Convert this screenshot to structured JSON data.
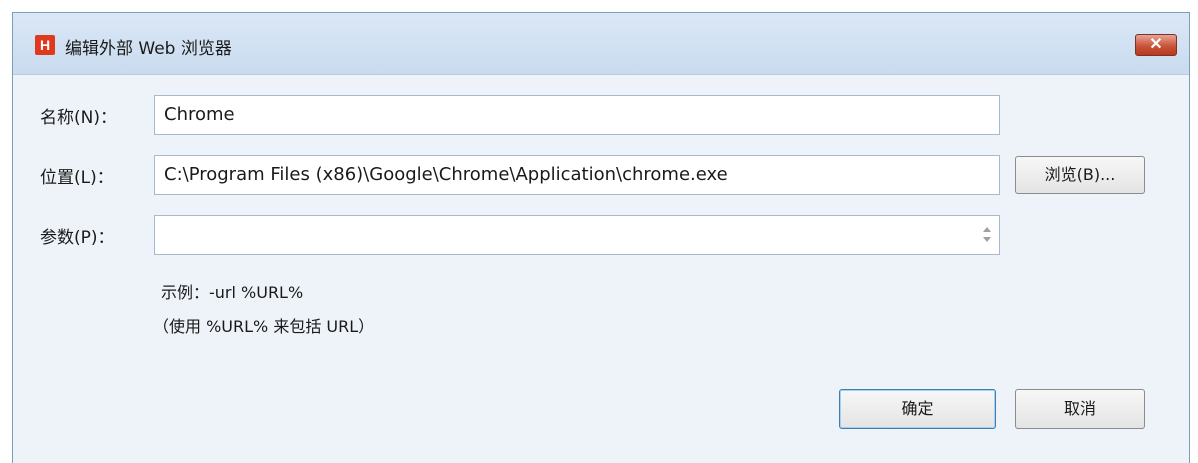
{
  "window": {
    "title": "编辑外部 Web 浏览器",
    "app_icon_letter": "H",
    "close_label": "✕"
  },
  "form": {
    "name_label": "名称(N)：",
    "name_value": "Chrome",
    "location_label": "位置(L)：",
    "location_value": "C:\\Program Files (x86)\\Google\\Chrome\\Application\\chrome.exe",
    "browse_label": "浏览(B)...",
    "params_label": "参数(P)：",
    "params_value": "",
    "hint_line1": "示例：-url %URL%",
    "hint_line2": "（使用 %URL% 来包括 URL）"
  },
  "buttons": {
    "ok_label": "确定",
    "cancel_label": "取消"
  },
  "colors": {
    "app_icon": "#e03a1e",
    "close_button": "#c9543a",
    "window_bg": "#eef3fa"
  }
}
